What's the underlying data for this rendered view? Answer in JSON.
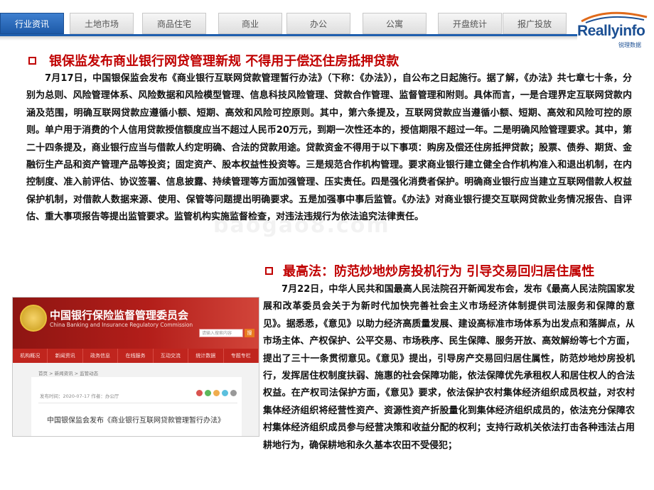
{
  "nav": {
    "tabs": [
      {
        "label": "行业资讯",
        "active": true
      },
      {
        "label": "土地市场",
        "active": false
      },
      {
        "label": "商品住宅",
        "active": false
      },
      {
        "label": "商业",
        "active": false
      },
      {
        "label": "办公",
        "active": false
      },
      {
        "label": "公寓",
        "active": false
      },
      {
        "label": "开盘统计",
        "active": false
      },
      {
        "label": "报广投放",
        "active": false
      }
    ]
  },
  "logo": {
    "brand": "Reallyinfo",
    "sub": "锐理数据"
  },
  "colors": {
    "accent_blue": "#1f5fae",
    "heading_red": "#c00000"
  },
  "article1": {
    "heading": "银保监发布商业银行网贷管理新规 不得用于偿还住房抵押贷款",
    "body": "7月17日，中国银保监会发布《商业银行互联网贷款管理暂行办法》（下称：《办法》），自公布之日起施行。据了解，《办法》共七章七十条，分别为总则、风险管理体系、风险数据和风险模型管理、信息科技风险管理、贷款合作管理、监督管理和附则。具体而言，一是合理界定互联网贷款内涵及范围，明确互联网贷款应遵循小额、短期、高效和风险可控原则。其中，第六条提及，互联网贷款应当遵循小额、短期、高效和风险可控的原则。单户用于消费的个人信用贷款授信额度应当不超过人民币20万元，到期一次性还本的，授信期限不超过一年。二是明确风险管理要求。其中，第二十四条提及，商业银行应当与借款人约定明确、合法的贷款用途。贷款资金不得用于以下事项：购房及偿还住房抵押贷款；股票、债券、期货、金融衍生产品和资产管理产品等投资；固定资产、股本权益性投资等。三是规范合作机构管理。要求商业银行建立健全合作机构准入和退出机制，在内控制度、准入前评估、协议签署、信息披露、持续管理等方面加强管理、压实责任。四是强化消费者保护。明确商业银行应当建立互联网借款人权益保护机制，对借款人数据来源、使用、保管等问题提出明确要求。五是加强事中事后监管。《办法》对商业银行提交互联网贷款业务情况报告、自评估、重大事项报告等提出监管要求。监管机构实施监督检查，对违法违规行为依法追究法律责任。"
  },
  "article2": {
    "heading": "最高法：防范炒地炒房投机行为 引导交易回归居住属性",
    "body": "7月22日，中华人民共和国最高人民法院召开新闻发布会，发布《最高人民法院国家发展和改革委员会关于为新时代加快完善社会主义市场经济体制提供司法服务和保障的意见》。据悉悉，《意见》以助力经济高质量发展、建设高标准市场体系为出发点和落脚点，从市场主体、产权保护、公平交易、市场秩序、民生保障、服务开放、高效解纷等七个方面，提出了三十一条贯彻意见。《意见》提出，引导房产交易回归居住属性，防范炒地炒房投机行，发挥居住权制度扶弱、施惠的社会保障功能，依法保障优先承租权人和居住权人的合法权益。在产权司法保护方面，《意见》要求，依法保护农村集体经济组织成员权益，对农村集体经济组织将经营性资产、资源性资产折股量化到集体经济组织成员的，依法充分保障农村集体经济组织成员参与经营决策和收益分配的权利；支持行政机关依法打击各种违法占用耕地行为，确保耕地和永久基本农田不受侵犯；"
  },
  "screenshot": {
    "cn_title": "中国银行保险监督管理委员会",
    "en_title": "China Banking and Insurance Regulatory Commission",
    "search_placeholder": "请输入搜索内容",
    "search_button": "搜",
    "menu": [
      "机构概况",
      "新闻资讯",
      "政务信息",
      "在线服务",
      "互动交流",
      "统计数据",
      "专题专栏"
    ],
    "breadcrumb": "首页 > 新闻资讯 > 监管动态",
    "meta": "发布时间：2020-07-17    作者：办公厅",
    "article_title": "中国银保监会发布《商业银行互联网贷款管理暂行办法》"
  }
}
